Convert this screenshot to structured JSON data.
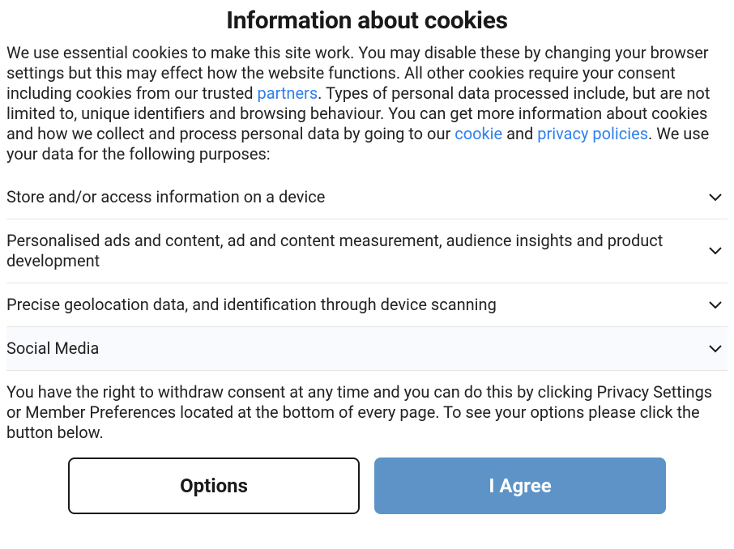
{
  "title": "Information about cookies",
  "intro": {
    "seg1": "We use essential cookies to make this site work. You may disable these by changing your browser settings but this may effect how the website functions. All other cookies require your consent including cookies from our trusted ",
    "link_partners": "partners",
    "seg2": ". Types of personal data processed include, but are not limited to, unique identifiers and browsing behaviour. You can get more information about cookies and how we collect and process personal data by going to our ",
    "link_cookie": "cookie",
    "seg3": " and ",
    "link_privacy": "privacy policies",
    "seg4": ". We use your data for the following purposes:"
  },
  "purposes": [
    {
      "label": "Store and/or access information on a device"
    },
    {
      "label": "Personalised ads and content, ad and content measurement, audience insights and product development"
    },
    {
      "label": "Precise geolocation data, and identification through device scanning"
    },
    {
      "label": "Social Media"
    }
  ],
  "footer_text": "You have the right to withdraw consent at any time and you can do this by clicking Privacy Settings or Member Preferences located at the bottom of every page. To see your options please click the button below.",
  "buttons": {
    "options": "Options",
    "agree": "I Agree"
  }
}
